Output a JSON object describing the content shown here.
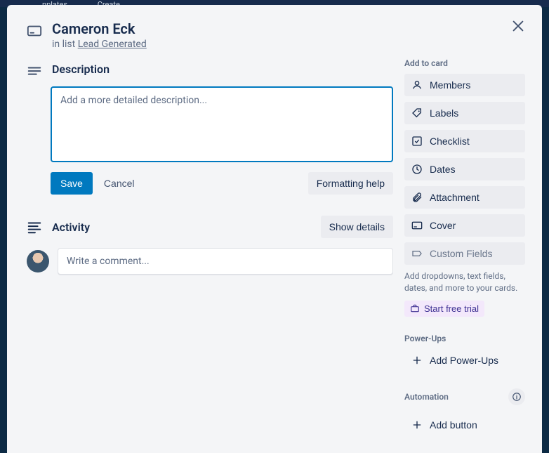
{
  "bgNav": {
    "item1": "nplates",
    "item2": "Create"
  },
  "card": {
    "title": "Cameron Eck",
    "inListPrefix": "in list ",
    "listName": "Lead Generated"
  },
  "description": {
    "heading": "Description",
    "placeholder": "Add a more detailed description...",
    "save": "Save",
    "cancel": "Cancel",
    "formattingHelp": "Formatting help"
  },
  "activity": {
    "heading": "Activity",
    "showDetails": "Show details",
    "commentPlaceholder": "Write a comment..."
  },
  "sidebar": {
    "addToCard": "Add to card",
    "members": "Members",
    "labels": "Labels",
    "checklist": "Checklist",
    "dates": "Dates",
    "attachment": "Attachment",
    "cover": "Cover",
    "customFields": "Custom Fields",
    "customFieldsNote": "Add dropdowns, text fields, dates, and more to your cards.",
    "startTrial": "Start free trial",
    "powerUpsHeading": "Power-Ups",
    "addPowerUps": "Add Power-Ups",
    "automationHeading": "Automation",
    "addButton": "Add button"
  }
}
